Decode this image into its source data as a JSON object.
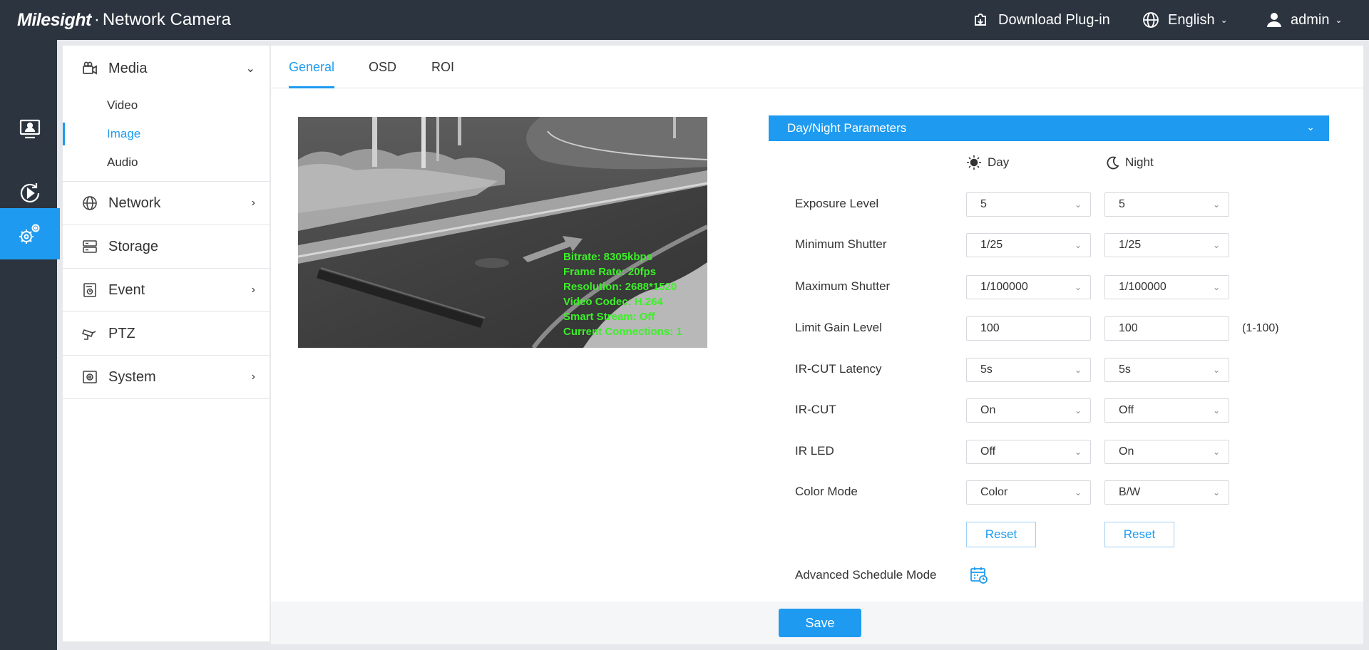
{
  "header": {
    "brand": "Milesight",
    "product": "Network Camera",
    "download_label": "Download Plug-in",
    "language": "English",
    "user": "admin"
  },
  "rail": [
    {
      "name": "live-view",
      "icon": "monitor-user-icon"
    },
    {
      "name": "playback",
      "icon": "play-refresh-icon"
    },
    {
      "name": "settings",
      "icon": "gears-icon",
      "active": true
    }
  ],
  "sidebar": {
    "media": {
      "label": "Media",
      "sub": [
        "Video",
        "Image",
        "Audio"
      ],
      "active_sub": "Image"
    },
    "items": [
      {
        "label": "Network",
        "has_children": true
      },
      {
        "label": "Storage",
        "has_children": false
      },
      {
        "label": "Event",
        "has_children": true
      },
      {
        "label": "PTZ",
        "has_children": false
      },
      {
        "label": "System",
        "has_children": true
      }
    ]
  },
  "tabs": [
    {
      "label": "General",
      "active": true
    },
    {
      "label": "OSD"
    },
    {
      "label": "ROI"
    }
  ],
  "preview": {
    "osd_lines": [
      "Bitrate: 8305kbps",
      "Frame Rate: 20fps",
      "Resolution: 2688*1520",
      "Video Codec: H.264",
      "Smart Stream: Off",
      "Current Connections: 1"
    ]
  },
  "section": {
    "title": "Day/Night Parameters",
    "day_label": "Day",
    "night_label": "Night",
    "rows": [
      {
        "label": "Exposure Level",
        "type": "select",
        "day": "5",
        "night": "5"
      },
      {
        "label": "Minimum Shutter",
        "type": "select",
        "day": "1/25",
        "night": "1/25"
      },
      {
        "label": "Maximum Shutter",
        "type": "select",
        "day": "1/100000",
        "night": "1/100000"
      },
      {
        "label": "Limit Gain Level",
        "type": "input",
        "day": "100",
        "night": "100",
        "hint": "(1-100)"
      },
      {
        "label": "IR-CUT Latency",
        "type": "select",
        "day": "5s",
        "night": "5s"
      },
      {
        "label": "IR-CUT",
        "type": "select",
        "day": "On",
        "night": "Off"
      },
      {
        "label": "IR LED",
        "type": "select",
        "day": "Off",
        "night": "On"
      },
      {
        "label": "Color Mode",
        "type": "select",
        "day": "Color",
        "night": "B/W"
      }
    ],
    "reset_label": "Reset",
    "advanced_label": "Advanced Schedule Mode"
  },
  "footer": {
    "save_label": "Save"
  },
  "colors": {
    "accent": "#1e9bf0",
    "topbar": "#2b343f",
    "osd_text": "#3cf028"
  }
}
